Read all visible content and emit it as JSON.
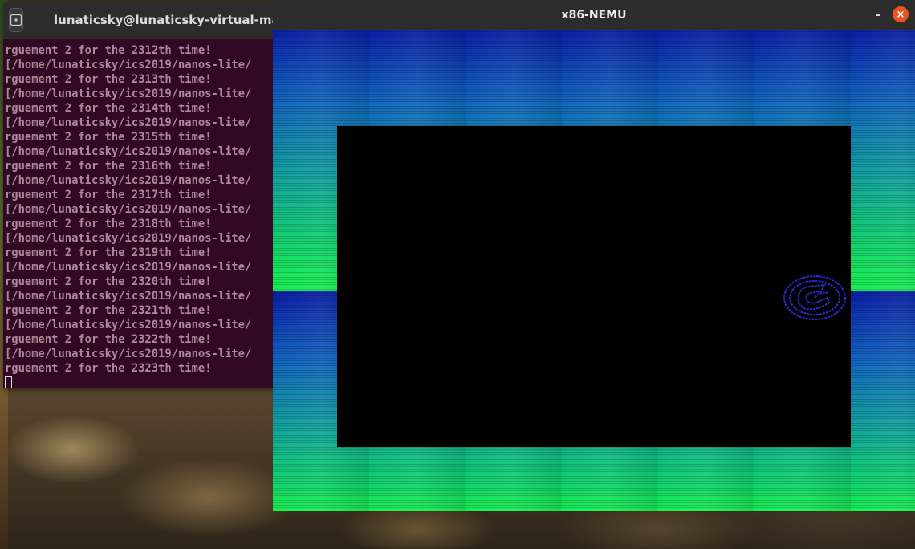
{
  "terminal": {
    "title": "lunaticsky@lunaticsky-virtual-machi",
    "lines": [
      "rguement 2 for the 2312th time!",
      "[/home/lunaticsky/ics2019/nanos-lite/",
      "rguement 2 for the 2313th time!",
      "[/home/lunaticsky/ics2019/nanos-lite/",
      "rguement 2 for the 2314th time!",
      "[/home/lunaticsky/ics2019/nanos-lite/",
      "rguement 2 for the 2315th time!",
      "[/home/lunaticsky/ics2019/nanos-lite/",
      "rguement 2 for the 2316th time!",
      "[/home/lunaticsky/ics2019/nanos-lite/",
      "rguement 2 for the 2317th time!",
      "[/home/lunaticsky/ics2019/nanos-lite/",
      "rguement 2 for the 2318th time!",
      "[/home/lunaticsky/ics2019/nanos-lite/",
      "rguement 2 for the 2319th time!",
      "[/home/lunaticsky/ics2019/nanos-lite/",
      "rguement 2 for the 2320th time!",
      "[/home/lunaticsky/ics2019/nanos-lite/",
      "rguement 2 for the 2321th time!",
      "[/home/lunaticsky/ics2019/nanos-lite/",
      "rguement 2 for the 2322th time!",
      "[/home/lunaticsky/ics2019/nanos-lite/",
      "rguement 2 for the 2323th time!"
    ],
    "text_color": "#b0889a",
    "background": "#300a24"
  },
  "nemu": {
    "title": "x86-NEMU",
    "minimize_glyph": "–",
    "close_glyph": "×",
    "close_color": "#e95420"
  },
  "icons": {
    "new_tab": "new-tab-icon",
    "logo": "nemu-logo-icon"
  }
}
